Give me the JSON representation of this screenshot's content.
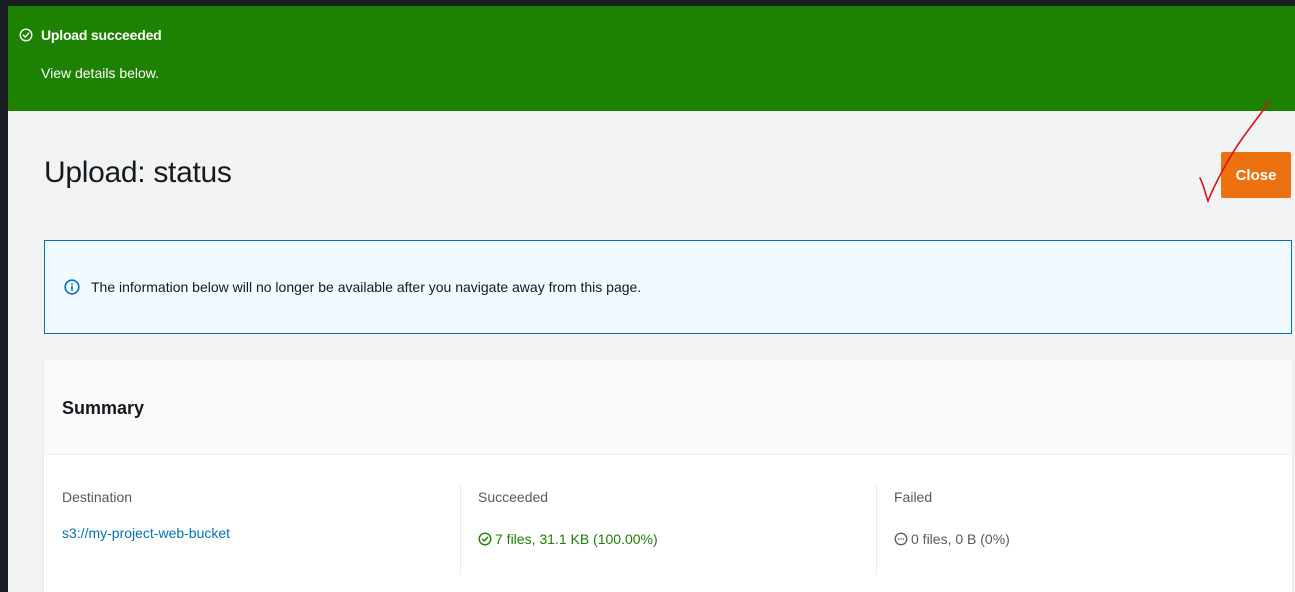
{
  "flash": {
    "title": "Upload succeeded",
    "subtitle": "View details below.",
    "icon": "check-circle-icon",
    "color": "#1d8102"
  },
  "header": {
    "title": "Upload: status",
    "close_label": "Close",
    "close_color": "#ec7211"
  },
  "info_alert": {
    "icon": "info-icon",
    "text": "The information below will no longer be available after you navigate away from this page."
  },
  "summary": {
    "title": "Summary",
    "destination": {
      "label": "Destination",
      "value": "s3://my-project-web-bucket"
    },
    "succeeded": {
      "label": "Succeeded",
      "value": "7 files, 31.1 KB (100.00%)",
      "icon": "check-circle-icon"
    },
    "failed": {
      "label": "Failed",
      "value": "0 files, 0 B (0%)",
      "icon": "minus-circle-icon"
    }
  }
}
